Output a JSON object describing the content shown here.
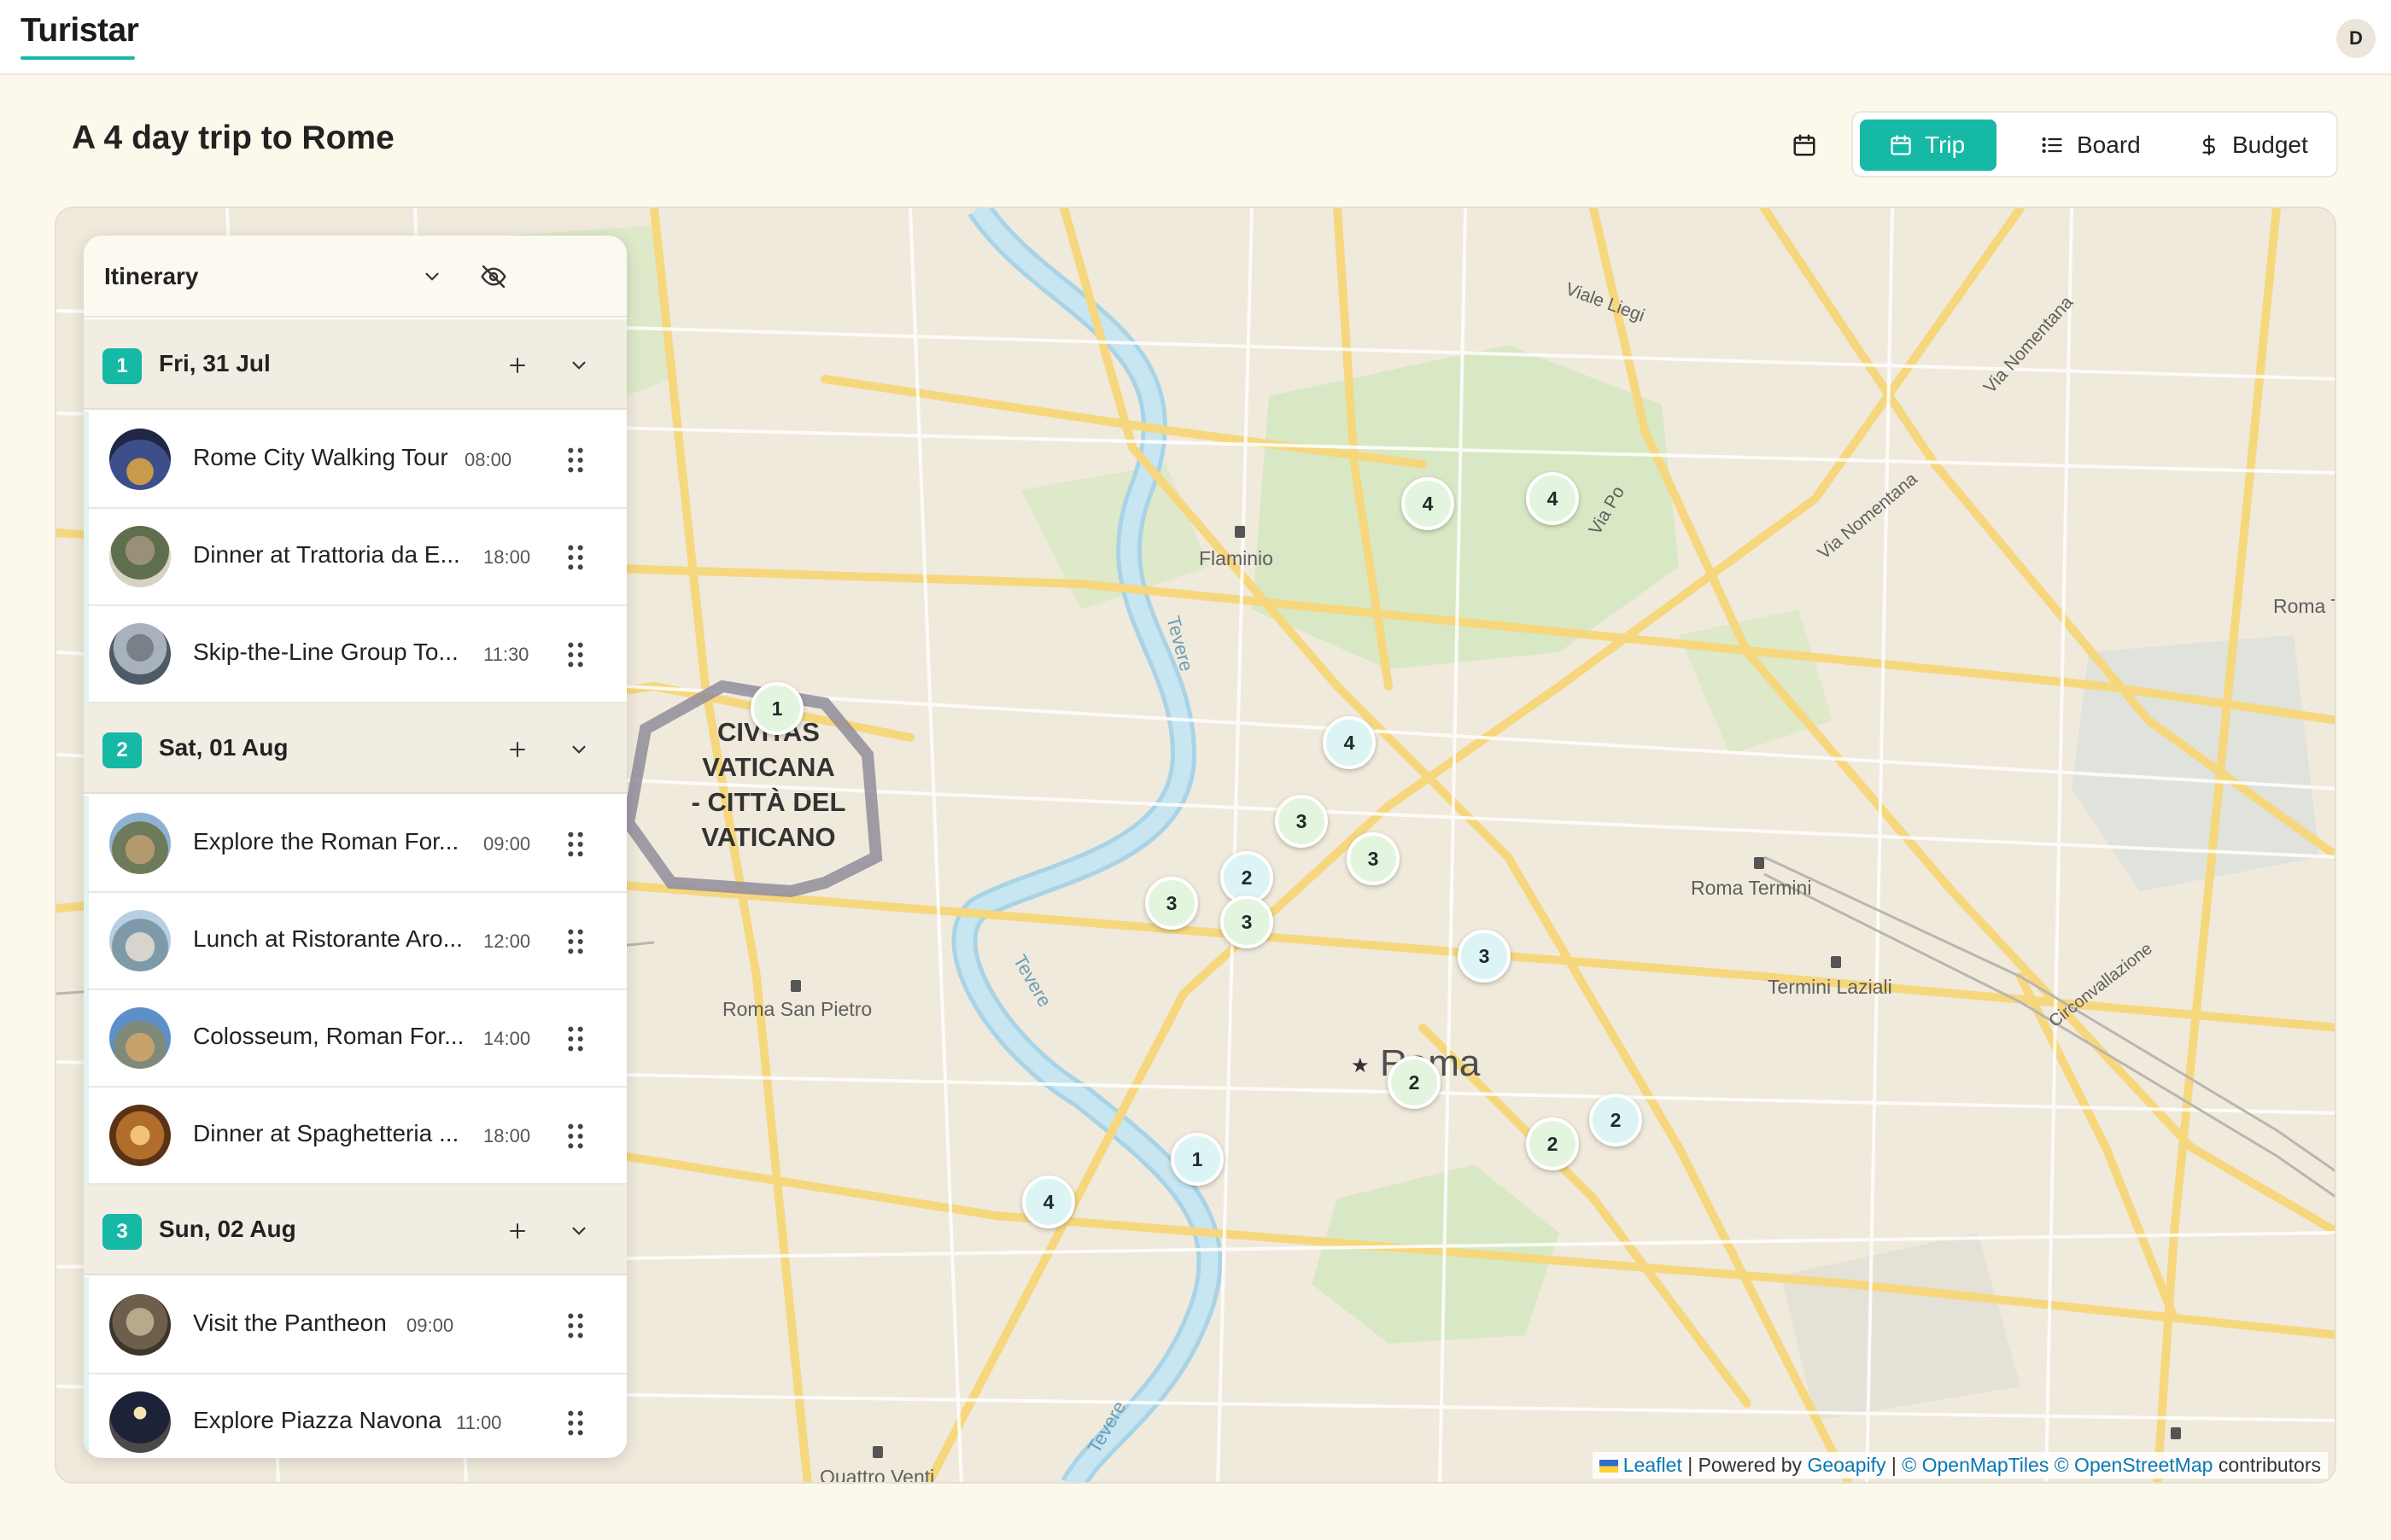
{
  "app": {
    "brand": "Turistar",
    "user_initial": "D"
  },
  "page": {
    "title": "A 4 day trip to Rome"
  },
  "view_switch": {
    "trip": "Trip",
    "board": "Board",
    "budget": "Budget",
    "active": "trip"
  },
  "itinerary": {
    "title": "Itinerary",
    "days": [
      {
        "number": "1",
        "label": "Fri, 31 Jul",
        "items": [
          {
            "name": "Rome City Walking Tour",
            "time": "08:00"
          },
          {
            "name": "Dinner at Trattoria da E...",
            "time": "18:00"
          },
          {
            "name": "Skip-the-Line Group To...",
            "time": "11:30"
          }
        ]
      },
      {
        "number": "2",
        "label": "Sat, 01 Aug",
        "items": [
          {
            "name": "Explore the Roman For...",
            "time": "09:00"
          },
          {
            "name": "Lunch at Ristorante Aro...",
            "time": "12:00"
          },
          {
            "name": "Colosseum, Roman For...",
            "time": "14:00"
          },
          {
            "name": "Dinner at Spaghetteria ...",
            "time": "18:00"
          }
        ]
      },
      {
        "number": "3",
        "label": "Sun, 02 Aug",
        "items": [
          {
            "name": "Visit the Pantheon",
            "time": "09:00"
          },
          {
            "name": "Explore Piazza Navona",
            "time": "11:00"
          }
        ]
      }
    ]
  },
  "map": {
    "labels": {
      "flaminio": "Flaminio",
      "vatican_1": "CIVITAS",
      "vatican_2": "VATICANA",
      "vatican_3": "- CITTÀ DEL",
      "vatican_4": "VATICANO",
      "roma": "Roma",
      "roma_termini": "Roma Termini",
      "termini_laziali": "Termini Laziali",
      "roma_san_pietro": "Roma San Pietro",
      "roma_tib": "Roma Ti",
      "viale_liegi": "Viale Liegi",
      "via_po": "Via Po",
      "via_nomentana": "Via Nomentana",
      "via_nomentana_2": "Via Nomentana",
      "tevere_1": "Tevere",
      "tevere_2": "Tevere",
      "tevere_3": "Tevere",
      "circonvallazione": "Circonvallazione",
      "quattro_venti": "Quattro Venti"
    },
    "markers": [
      "1",
      "4",
      "4",
      "4",
      "3",
      "3",
      "2",
      "3",
      "3",
      "3",
      "2",
      "2",
      "2",
      "1",
      "4"
    ],
    "attribution": {
      "leaflet": "Leaflet",
      "sep1": " | Powered by ",
      "geoapify": "Geoapify",
      "sep2": " | ",
      "omt": "© OpenMapTiles",
      "sep3": " ",
      "osm": "© OpenStreetMap",
      "contrib": " contributors"
    }
  },
  "colors": {
    "accent": "#16b8a6",
    "background": "#fdf8ec",
    "marker_green": "#e4f5df",
    "marker_cyan": "#ddf4f4"
  }
}
